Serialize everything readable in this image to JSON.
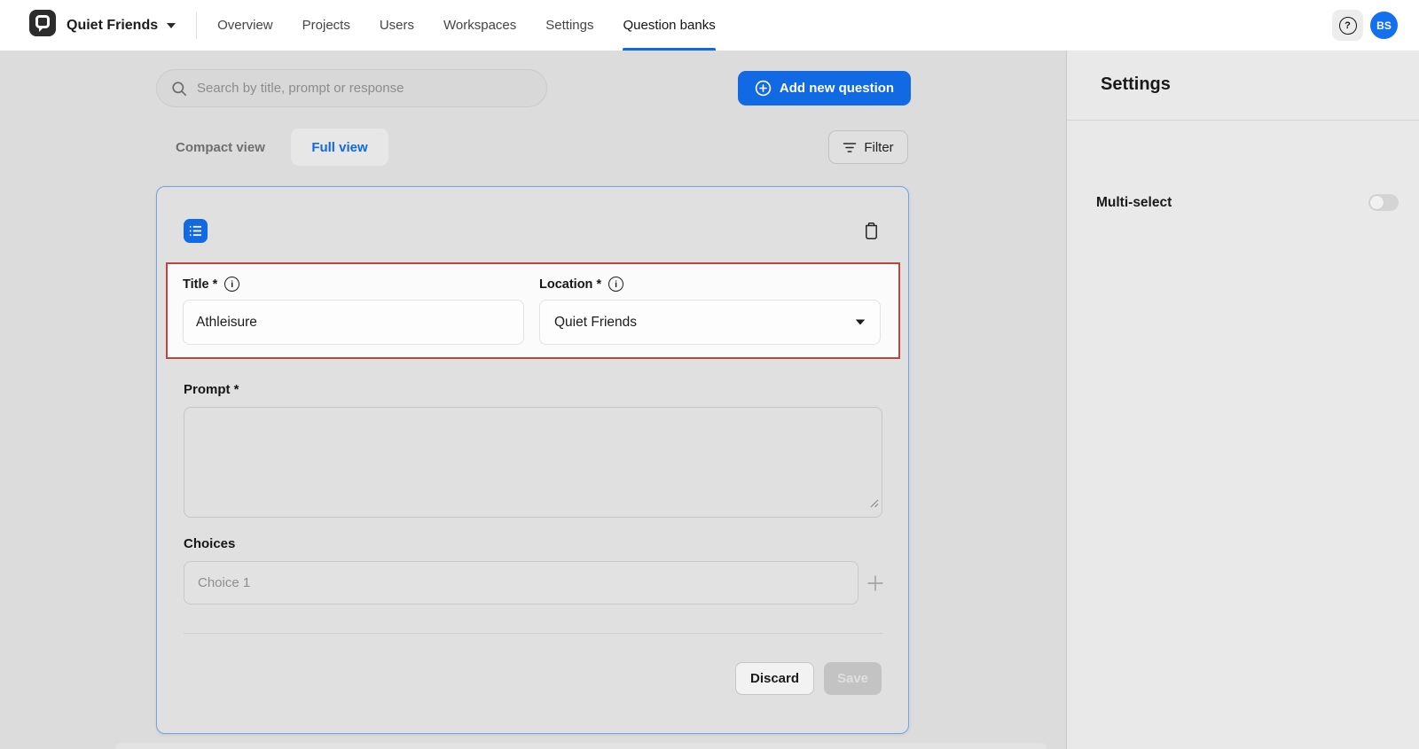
{
  "header": {
    "org": {
      "name": "Quiet Friends"
    },
    "nav": [
      {
        "label": "Overview",
        "active": false
      },
      {
        "label": "Projects",
        "active": false
      },
      {
        "label": "Users",
        "active": false
      },
      {
        "label": "Workspaces",
        "active": false
      },
      {
        "label": "Settings",
        "active": false
      },
      {
        "label": "Question banks",
        "active": true
      }
    ],
    "avatar_initials": "BS"
  },
  "toolbar": {
    "search_placeholder": "Search by title, prompt or response",
    "add_question_label": "Add new question"
  },
  "view_switch": {
    "compact_label": "Compact view",
    "full_label": "Full view",
    "filter_label": "Filter"
  },
  "question_card": {
    "title_label": "Title *",
    "title_value": "Athleisure",
    "location_label": "Location *",
    "location_value": "Quiet Friends",
    "prompt_label": "Prompt *",
    "prompt_value": "",
    "choices_label": "Choices",
    "choice_placeholder": "Choice 1",
    "discard_label": "Discard",
    "save_label": "Save"
  },
  "settings_panel": {
    "title": "Settings",
    "multi_select_label": "Multi-select",
    "multi_select_enabled": false
  },
  "icons": {
    "info_glyph": "i",
    "help_glyph": "?"
  },
  "colors": {
    "accent_blue": "#1169e4",
    "avatar_blue": "#1570ef",
    "card_border_blue": "#74a4e6",
    "annotation_red": "#c2423c",
    "page_background": "#dcdcdc",
    "sidebar_background": "#e9e9e9"
  }
}
